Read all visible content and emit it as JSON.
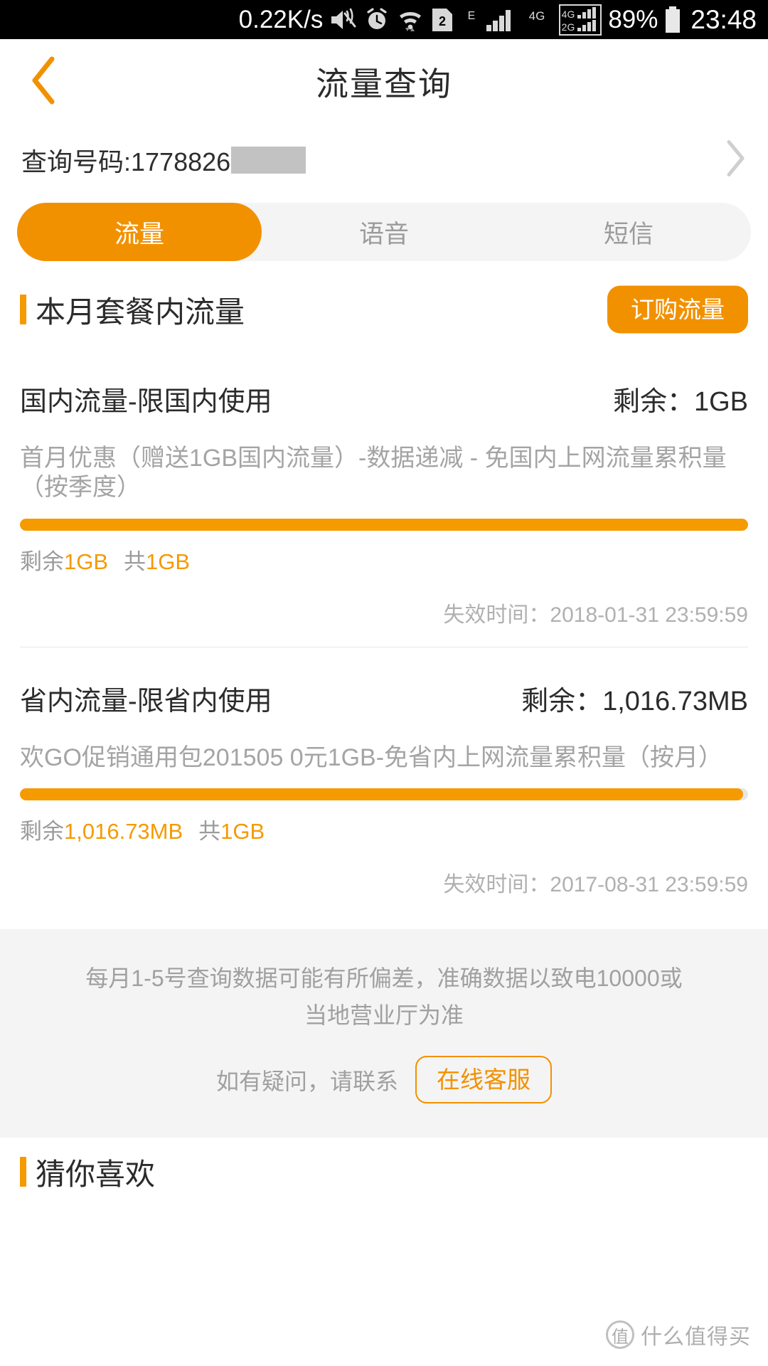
{
  "statusbar": {
    "net_speed": "0.22K/s",
    "icons": [
      "mute-icon",
      "alarm-icon",
      "wifi-icon",
      "sim2-icon",
      "edge-e-icon",
      "signal-bars-icon",
      "4g-icon",
      "dual-4g-2g-icon"
    ],
    "battery_percent": "89%",
    "time": "23:48"
  },
  "navbar": {
    "back_icon": "chevron-left-icon",
    "title": "流量查询"
  },
  "query": {
    "label": "查询号码:1778826",
    "arrow_icon": "chevron-right-icon"
  },
  "tabs": [
    {
      "label": "流量",
      "active": true
    },
    {
      "label": "语音",
      "active": false
    },
    {
      "label": "短信",
      "active": false
    }
  ],
  "section": {
    "title": "本月套餐内流量",
    "order_button": "订购流量"
  },
  "packages": [
    {
      "name": "国内流量-限国内使用",
      "remaining_label": "剩余：1GB",
      "description": "首月优惠（赠送1GB国内流量）-数据递减 - 免国内上网流量累积量（按季度）",
      "progress_percent": 100,
      "legend_prefix": "剩余",
      "legend_remaining": "1GB",
      "legend_total_prefix": "共",
      "legend_total": "1GB",
      "expiry": "失效时间：2018-01-31 23:59:59"
    },
    {
      "name": "省内流量-限省内使用",
      "remaining_label": "剩余：1,016.73MB",
      "description": "欢GO促销通用包201505 0元1GB-免省内上网流量累积量（按月）",
      "progress_percent": 99.3,
      "legend_prefix": "剩余",
      "legend_remaining": "1,016.73MB",
      "legend_total_prefix": "共",
      "legend_total": "1GB",
      "expiry": "失效时间：2017-08-31 23:59:59"
    }
  ],
  "notice": {
    "line1": "每月1-5号查询数据可能有所偏差，准确数据以致电10000或",
    "line2": "当地营业厅为准",
    "ask": "如有疑问，请联系",
    "cs_button": "在线客服"
  },
  "bottom": {
    "title": "猜你喜欢"
  },
  "watermark": {
    "badge": "值",
    "text": "什么值得买"
  },
  "colors": {
    "accent": "#f29100",
    "accent_bar": "#f59a00",
    "text_primary": "#2b2b2b",
    "text_muted": "#a0a0a0",
    "track": "#e6e6e6"
  }
}
